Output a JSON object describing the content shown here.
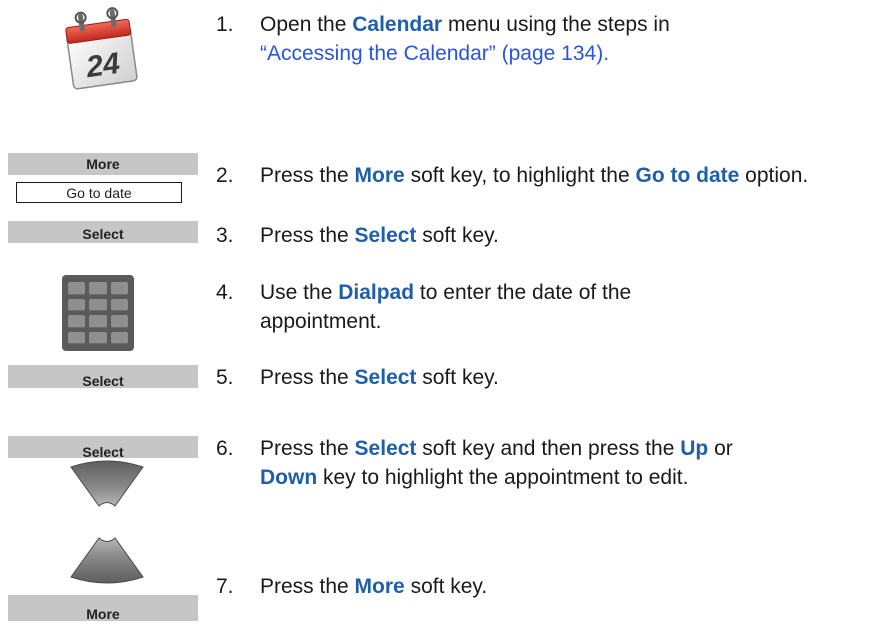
{
  "icons": {
    "calendar": "calendar-icon",
    "dialpad": "dialpad-icon",
    "up_key": "up-navigation-key-icon",
    "down_key": "down-navigation-key-icon"
  },
  "calendar_icon": {
    "day": "24"
  },
  "softkeys": {
    "more_1": "More",
    "go_to_date_option": "Go to date",
    "select_1": "Select",
    "select_2": "Select",
    "select_3": "Select",
    "more_2": "More"
  },
  "colors": {
    "keyword": "#1f5faa",
    "link": "#2a55d8",
    "softkey_bg": "#c6c6c6"
  },
  "steps": [
    {
      "num": "1.",
      "t1": "Open the ",
      "k1": "Calendar",
      "t2": " menu using the steps in ",
      "link": "“Accessing the Calendar” (page 134)",
      "t3": "."
    },
    {
      "num": "2.",
      "t1": "Press the ",
      "k1": "More",
      "t2": " soft key, to highlight the ",
      "k2": "Go to date",
      "t3": " option."
    },
    {
      "num": "3.",
      "t1": "Press the ",
      "k1": "Select",
      "t2": " soft key."
    },
    {
      "num": "4.",
      "t1": "Use the ",
      "k1": "Dialpad",
      "t2": " to enter the date of the appointment."
    },
    {
      "num": "5.",
      "t1": "Press the ",
      "k1": "Select",
      "t2": " soft key."
    },
    {
      "num": "6.",
      "t1": "Press the ",
      "k1": "Select",
      "t2": " soft key and then press the ",
      "k2": "Up",
      "t3": " or ",
      "k3": "Down",
      "t4": " key to highlight the appointment to edit."
    },
    {
      "num": "7.",
      "t1": "Press the ",
      "k1": "More",
      "t2": " soft key."
    }
  ]
}
